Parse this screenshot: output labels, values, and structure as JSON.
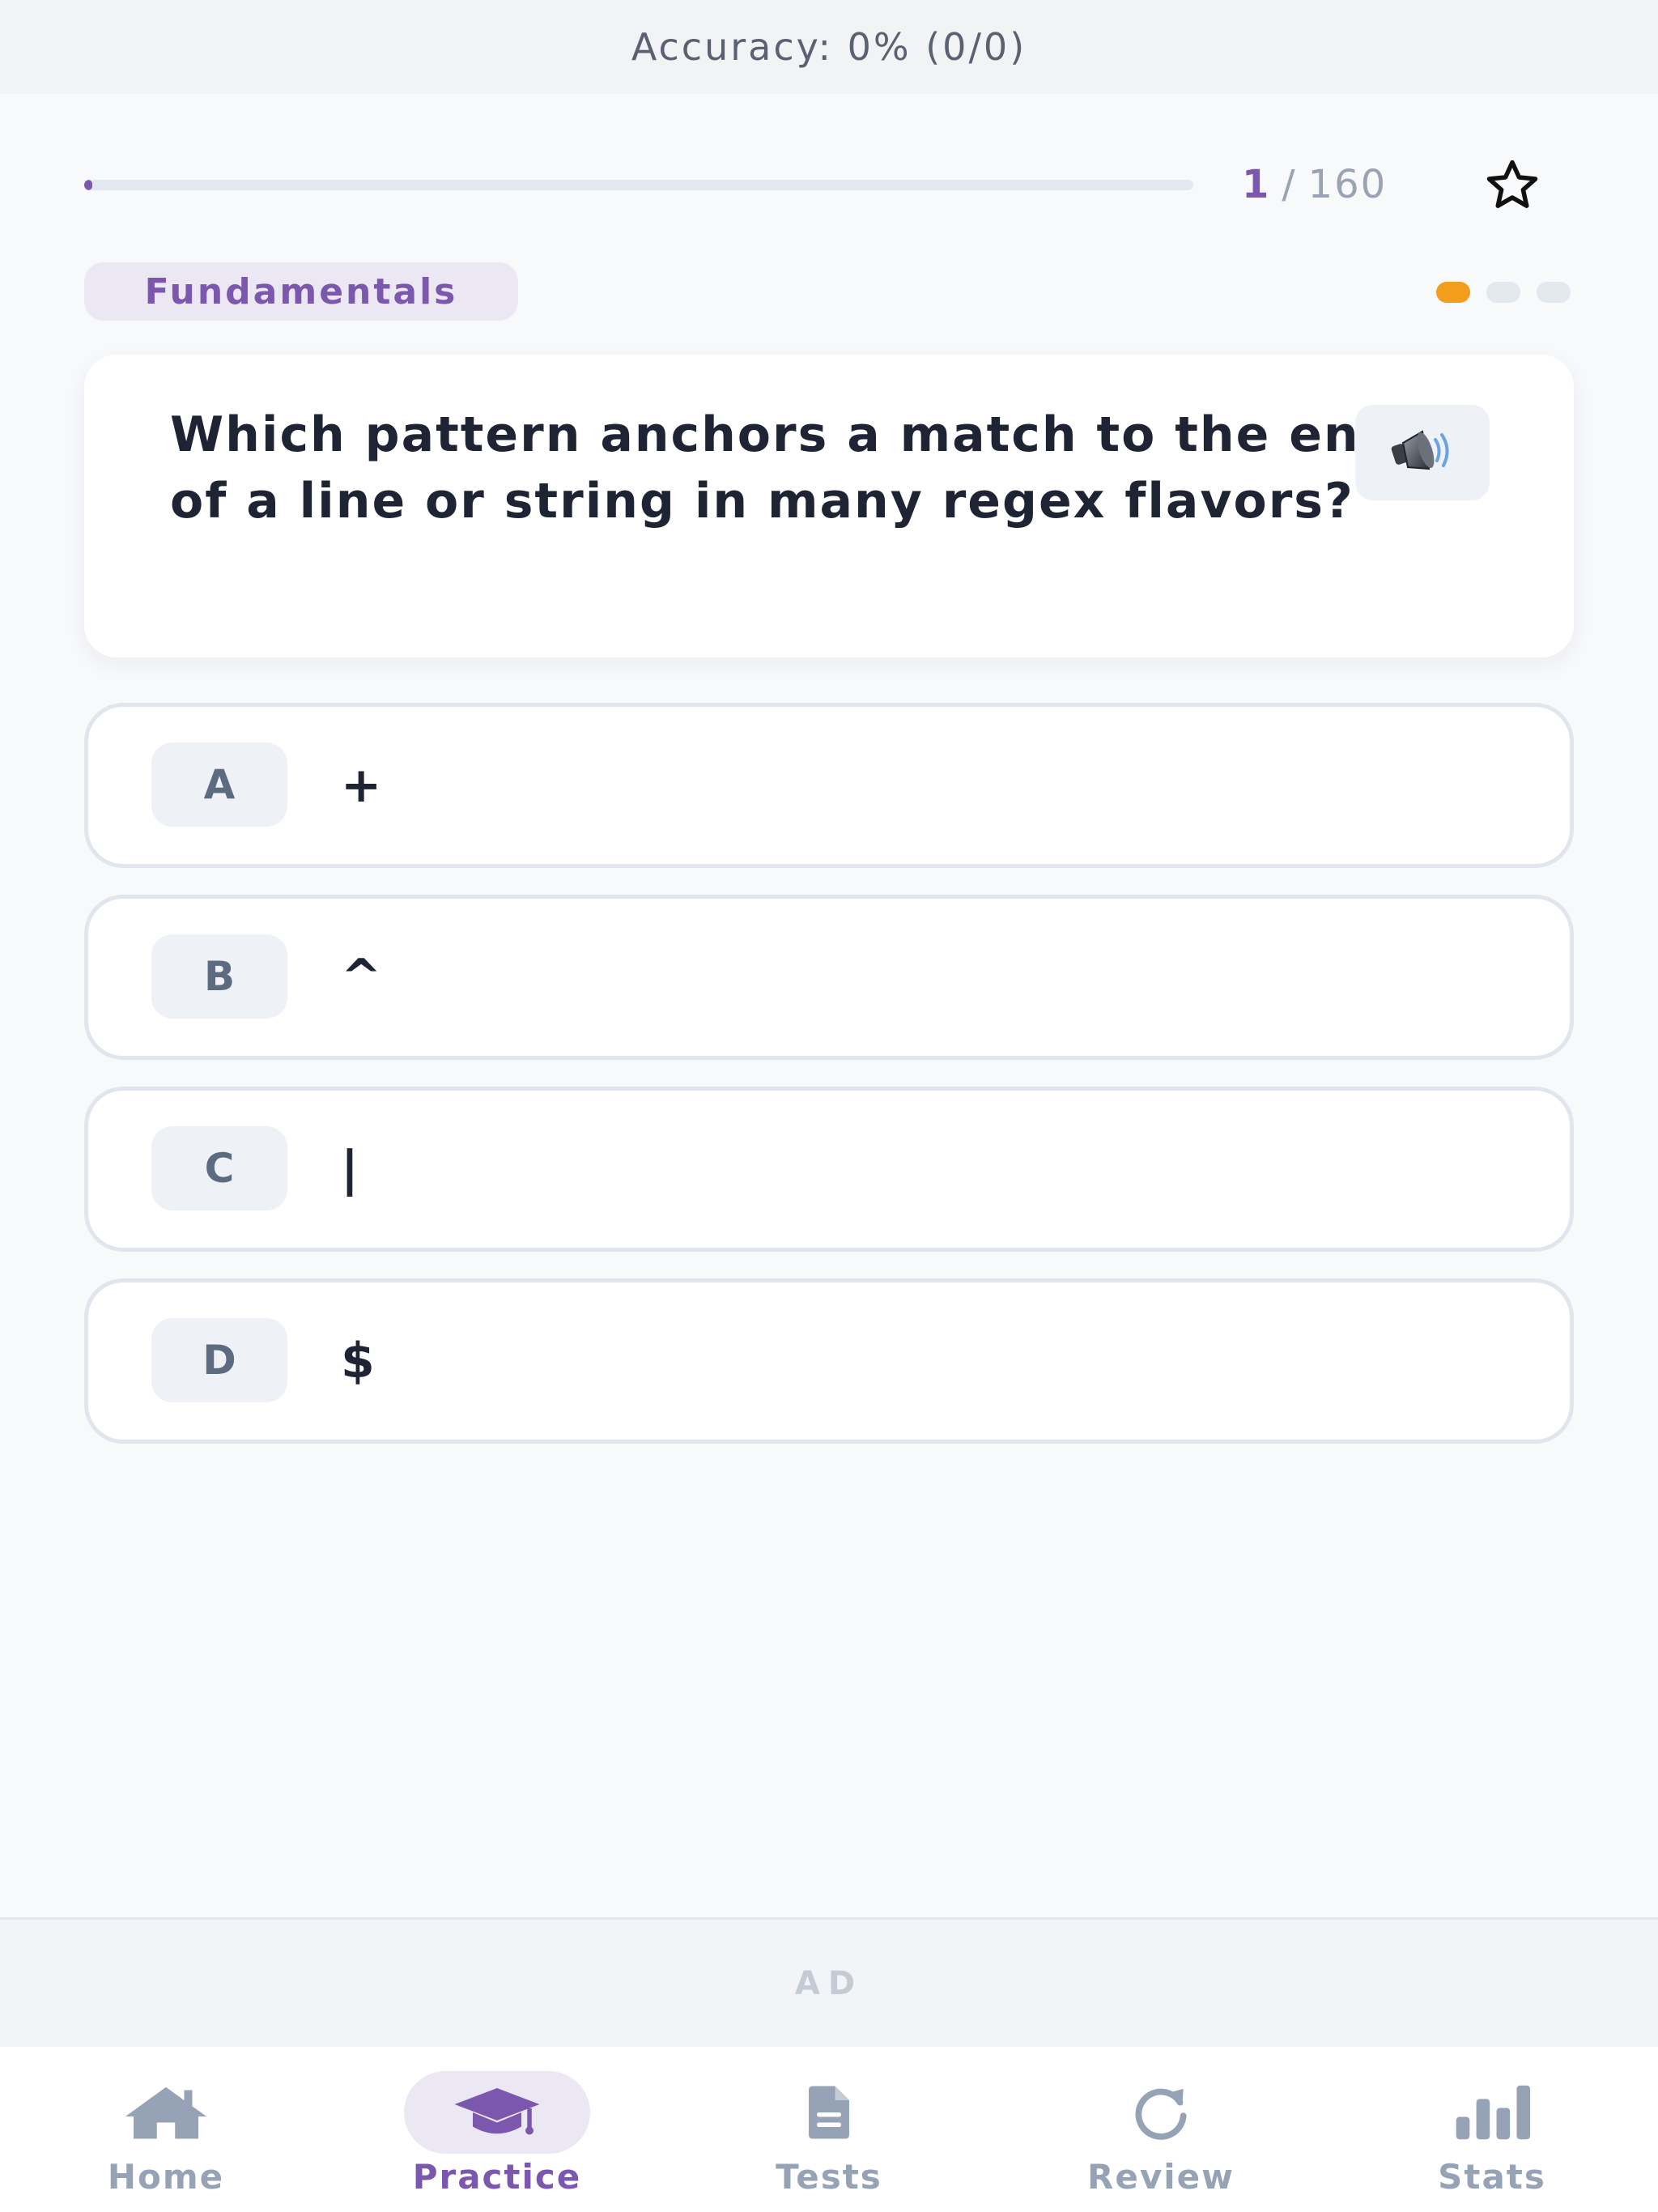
{
  "accuracy": {
    "text": "Accuracy: 0% (0/0)"
  },
  "progress": {
    "current": "1",
    "separator": "/",
    "total": "160",
    "fraction": 0.00625
  },
  "icons": {
    "favorite": "star-outline-icon",
    "audio": "speaker-icon"
  },
  "category": {
    "label": "Fundamentals"
  },
  "difficulty": {
    "level": 1,
    "max": 3
  },
  "question": {
    "text": "Which pattern anchors a match to the end of a line or string in many regex flavors?"
  },
  "options": [
    {
      "letter": "A",
      "text": "+"
    },
    {
      "letter": "B",
      "text": "^"
    },
    {
      "letter": "C",
      "text": "|"
    },
    {
      "letter": "D",
      "text": "$"
    }
  ],
  "ad": {
    "label": "AD"
  },
  "nav": {
    "items": [
      {
        "label": "Home",
        "icon": "home-icon",
        "active": false
      },
      {
        "label": "Practice",
        "icon": "graduation-cap-icon",
        "active": true
      },
      {
        "label": "Tests",
        "icon": "document-icon",
        "active": false
      },
      {
        "label": "Review",
        "icon": "refresh-icon",
        "active": false
      },
      {
        "label": "Stats",
        "icon": "bar-chart-icon",
        "active": false
      }
    ]
  },
  "colors": {
    "accent": "#7b57ad",
    "difficulty_active": "#f29d1b",
    "nav_inactive": "#96a2b5"
  }
}
